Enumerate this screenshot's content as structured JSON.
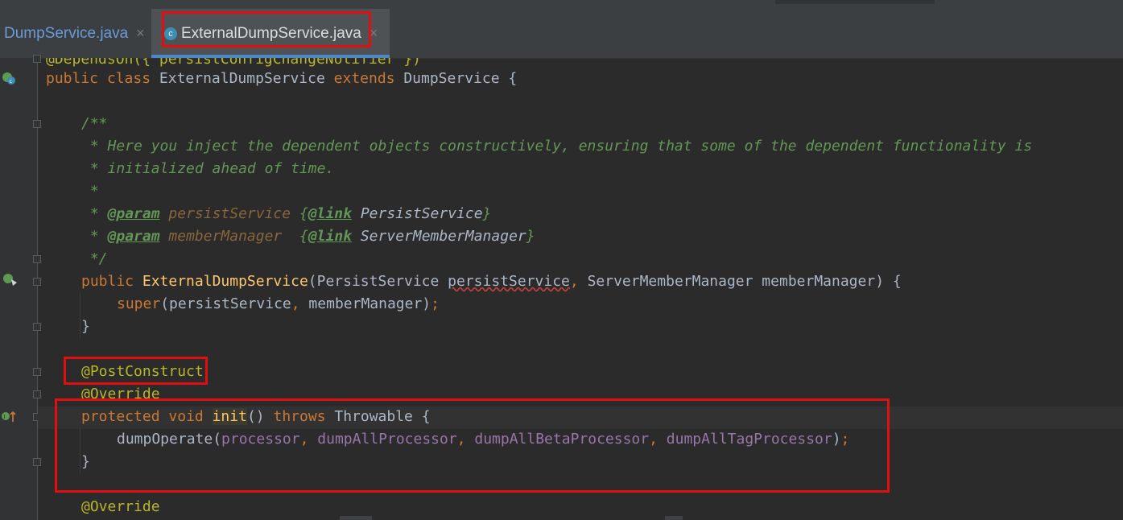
{
  "tabs": [
    {
      "label": "DumpService.java",
      "close": "×"
    },
    {
      "label": "ExternalDumpService.java",
      "close": "×",
      "icon": "class-icon",
      "icon_letter": "c"
    }
  ],
  "code": {
    "line0": "@DependsOn({\"persistConfigChangeNotifier\"})",
    "line1": {
      "public": "public",
      "class": "class",
      "name": " ExternalDumpService ",
      "extends": "extends",
      "rest": " DumpService {"
    },
    "doc_open": "/**",
    "doc_line1": " * Here you inject the dependent objects constructively, ensuring that some of the dependent functionality is",
    "doc_line2": " * initialized ahead of time.",
    "doc_line3": " *",
    "doc_param1": {
      "prefix": " * ",
      "tag": "@param",
      "name": "persistService",
      "link_open": "{",
      "link_tag": "@link",
      "type": "PersistService",
      "close": "}"
    },
    "doc_param2": {
      "prefix": " * ",
      "tag": "@param",
      "name": "memberManager",
      "link_open": "{",
      "link_tag": "@link",
      "type": "ServerMemberManager",
      "close": "}"
    },
    "doc_close": " */",
    "ctor": {
      "public": "public",
      "name": "ExternalDumpService",
      "p1": "(PersistService ",
      "p1name": "persistService",
      "comma": ",",
      "p2": " ServerMemberManager memberManager) {"
    },
    "super_line": {
      "super": "super",
      "args": "(persistService",
      "comma": ",",
      "args2": " memberManager)",
      "semi": ";"
    },
    "close_brace": "}",
    "post_construct": "@PostConstruct",
    "override1": "@Override",
    "init_line": {
      "protected": "protected",
      "void": "void",
      "init": "init",
      "paren": "()",
      "throws": "throws",
      "rest": " Throwable {"
    },
    "dump_line": {
      "call": "dumpOperate(",
      "a1": "processor",
      "a2": "dumpAllProcessor",
      "a3": "dumpAllBetaProcessor",
      "a4": "dumpAllTagProcessor",
      "end": ")",
      "semi": ";",
      "sep": ", "
    },
    "close_brace2": "}",
    "override2": "@Override"
  },
  "colors": {
    "highlight_box": "#e01010",
    "background": "#2b2b2b",
    "keyword": "#cc7832",
    "annotation": "#bbb529",
    "method": "#ffc66d",
    "field": "#9876aa",
    "comment": "#629755"
  },
  "icons": [
    "class-icon",
    "spring-bean-icon",
    "implements-method-icon",
    "override-up-arrow-icon",
    "fold-icon"
  ]
}
